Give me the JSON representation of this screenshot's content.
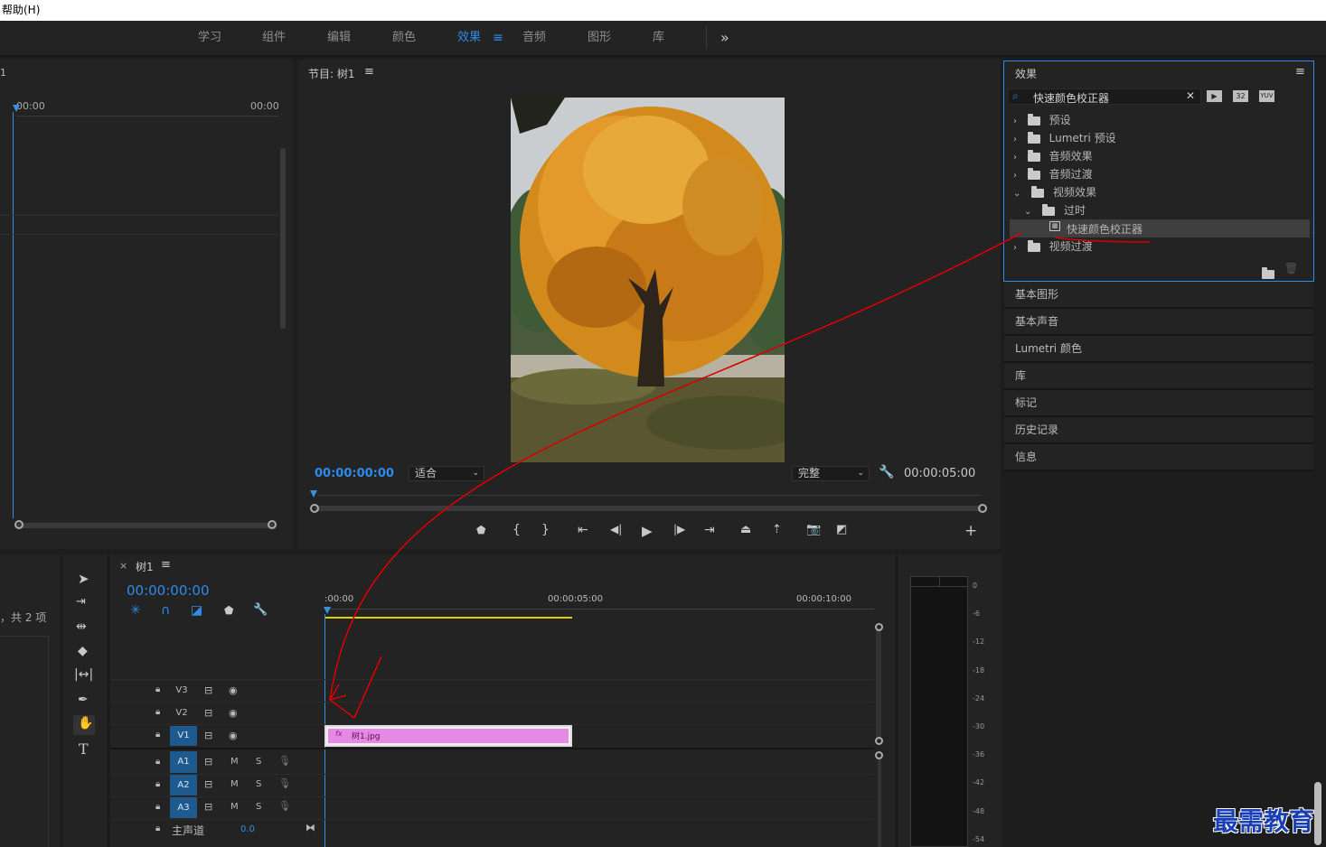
{
  "menubar": {
    "help": "帮助(H)"
  },
  "workspaces": [
    "学习",
    "组件",
    "编辑",
    "颜色",
    "效果",
    "音频",
    "图形",
    "库"
  ],
  "workspace_active": "效果",
  "workspace_more": "»",
  "source_panel": {
    "num": "1",
    "tc_left": "00:00",
    "tc_right": "00:00"
  },
  "program": {
    "title": "节目: 树1",
    "timecode": "00:00:00:00",
    "fit": "适合",
    "quality": "完整",
    "duration": "00:00:05:00"
  },
  "effects": {
    "title": "效果",
    "search_value": "快速颜色校正器",
    "badges": [
      "32",
      "YUV"
    ],
    "tree": [
      {
        "label": "预设",
        "kind": "preset",
        "expanded": false,
        "level": 0
      },
      {
        "label": "Lumetri 预设",
        "kind": "preset",
        "expanded": false,
        "level": 0
      },
      {
        "label": "音频效果",
        "kind": "folder",
        "expanded": false,
        "level": 0
      },
      {
        "label": "音频过渡",
        "kind": "folder",
        "expanded": false,
        "level": 0
      },
      {
        "label": "视频效果",
        "kind": "folder",
        "expanded": true,
        "level": 0
      },
      {
        "label": "过时",
        "kind": "folder",
        "expanded": true,
        "level": 1
      },
      {
        "label": "快速颜色校正器",
        "kind": "effect",
        "selected": true,
        "level": 2
      },
      {
        "label": "视频过渡",
        "kind": "folder",
        "expanded": false,
        "level": 0
      }
    ]
  },
  "side_panels": [
    "基本图形",
    "基本声音",
    "Lumetri 颜色",
    "库",
    "标记",
    "历史记录",
    "信息"
  ],
  "project_panel": {
    "count_text": "，共 2 项"
  },
  "timeline": {
    "close": "×",
    "title": "树1",
    "timecode": "00:00:00:00",
    "ruler": [
      ":00:00",
      "00:00:05:00",
      "00:00:10:00"
    ],
    "video_tracks": [
      "V3",
      "V2",
      "V1"
    ],
    "audio_tracks": [
      "A1",
      "A2",
      "A3"
    ],
    "mute": "M",
    "solo": "S",
    "master_label": "主声道",
    "master_value": "0.0",
    "clip_label": "树1.jpg",
    "clip_fx": "fx"
  },
  "meter_scale": [
    "0",
    "-6",
    "-12",
    "-18",
    "-24",
    "-30",
    "-36",
    "-42",
    "-48",
    "-54"
  ],
  "watermark": "最需教育",
  "colors": {
    "accent": "#2d8ceb",
    "clip": "#e58ae3",
    "annotation": "#d40000",
    "workarea": "#e0d000"
  }
}
